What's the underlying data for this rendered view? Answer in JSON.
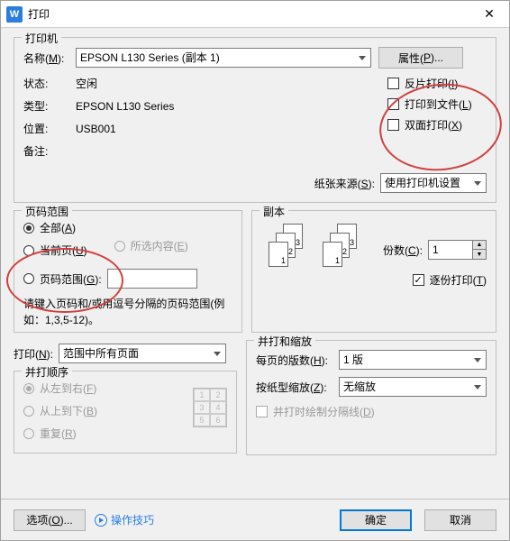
{
  "window": {
    "title": "打印"
  },
  "printer": {
    "legend": "打印机",
    "name_label_pre": "名称(",
    "name_key": "M",
    "name_label_post": "):",
    "name_value": "EPSON L130 Series (副本 1)",
    "props_pre": "属性(",
    "props_key": "P",
    "props_post": ")...",
    "status_label": "状态:",
    "status_value": "空闲",
    "type_label": "类型:",
    "type_value": "EPSON L130 Series",
    "where_label": "位置:",
    "where_value": "USB001",
    "comment_label": "备注:",
    "comment_value": "",
    "reverse_pre": "反片打印(",
    "reverse_key": "I",
    "reverse_post": ")",
    "tofile_pre": "打印到文件(",
    "tofile_key": "L",
    "tofile_post": ")",
    "duplex_pre": "双面打印(",
    "duplex_key": "X",
    "duplex_post": ")",
    "paper_source_pre": "纸张来源(",
    "paper_source_key": "S",
    "paper_source_post": "):",
    "paper_source_value": "使用打印机设置"
  },
  "range": {
    "legend": "页码范围",
    "all_pre": "全部(",
    "all_key": "A",
    "all_post": ")",
    "current_pre": "当前页(",
    "current_key": "U",
    "current_post": ")",
    "selection_pre": "所选内容(",
    "selection_key": "E",
    "selection_post": ")",
    "pages_pre": "页码范围(",
    "pages_key": "G",
    "pages_post": "):",
    "pages_value": "",
    "note": "请键入页码和/或用逗号分隔的页码范围(例如：1,3,5-12)。"
  },
  "copies": {
    "legend": "副本",
    "count_pre": "份数(",
    "count_key": "C",
    "count_post": "):",
    "count_value": "1",
    "collate_pre": "逐份打印(",
    "collate_key": "T",
    "collate_post": ")",
    "collate_checked": true
  },
  "print_what": {
    "label_pre": "打印(",
    "label_key": "N",
    "label_post": "):",
    "value": "范围中所有页面"
  },
  "order": {
    "legend": "并打顺序",
    "lr_pre": "从左到右(",
    "lr_key": "F",
    "lr_post": ")",
    "tb_pre": "从上到下(",
    "tb_key": "B",
    "tb_post": ")",
    "repeat_pre": "重复(",
    "repeat_key": "R",
    "repeat_post": ")"
  },
  "scale": {
    "legend": "并打和缩放",
    "ppp_pre": "每页的版数(",
    "ppp_key": "H",
    "ppp_post": "):",
    "ppp_value": "1 版",
    "zoom_pre": "按纸型缩放(",
    "zoom_key": "Z",
    "zoom_post": "):",
    "zoom_value": "无缩放",
    "sep_pre": "并打时绘制分隔线(",
    "sep_key": "D",
    "sep_post": ")"
  },
  "footer": {
    "options_pre": "选项(",
    "options_key": "O",
    "options_post": ")...",
    "tips": "操作技巧",
    "ok": "确定",
    "cancel": "取消"
  }
}
